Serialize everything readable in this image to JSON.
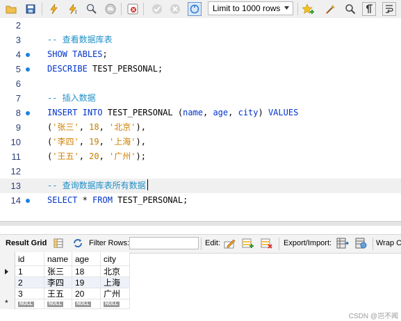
{
  "toolbar": {
    "limit_select": "Limit to 1000 rows",
    "icons": [
      "open-folder-icon",
      "save-icon",
      "execute-icon",
      "execute-current-icon",
      "explain-icon",
      "stop-icon",
      "toggle-error-icon",
      "commit-icon",
      "rollback-icon",
      "autocommit-icon",
      "limit-select",
      "bookmark-icon",
      "beautify-icon",
      "find-icon",
      "invisible-chars-icon",
      "wrap-icon"
    ]
  },
  "editor": {
    "lines": [
      {
        "num": "2",
        "dot": false,
        "code": ""
      },
      {
        "num": "3",
        "dot": false,
        "code": "-- 查看数据库表"
      },
      {
        "num": "4",
        "dot": true,
        "code": "SHOW TABLES;"
      },
      {
        "num": "5",
        "dot": true,
        "code": "DESCRIBE TEST_PERSONAL;"
      },
      {
        "num": "6",
        "dot": false,
        "code": ""
      },
      {
        "num": "7",
        "dot": false,
        "code": "-- 插入数据"
      },
      {
        "num": "8",
        "dot": true,
        "code": "INSERT INTO TEST_PERSONAL (name, age, city) VALUES"
      },
      {
        "num": "9",
        "dot": false,
        "code": "('张三', 18, '北京'),"
      },
      {
        "num": "10",
        "dot": false,
        "code": "('李四', 19, '上海'),"
      },
      {
        "num": "11",
        "dot": false,
        "code": "('王五', 20, '广州');"
      },
      {
        "num": "12",
        "dot": false,
        "code": ""
      },
      {
        "num": "13",
        "dot": false,
        "code": "-- 查询数据库表所有数据"
      },
      {
        "num": "14",
        "dot": true,
        "code": "SELECT * FROM TEST_PERSONAL;"
      }
    ]
  },
  "result_toolbar": {
    "result_grid": "Result Grid",
    "filter_rows": "Filter Rows:",
    "filter_value": "",
    "edit": "Edit:",
    "export_import": "Export/Import:",
    "wrap": "Wrap C"
  },
  "grid": {
    "columns": [
      "id",
      "name",
      "age",
      "city"
    ],
    "rows": [
      [
        "1",
        "张三",
        "18",
        "北京"
      ],
      [
        "2",
        "李四",
        "19",
        "上海"
      ],
      [
        "3",
        "王五",
        "20",
        "广州"
      ]
    ],
    "null_label": "NULL"
  },
  "watermark": "CSDN @岂不闻"
}
